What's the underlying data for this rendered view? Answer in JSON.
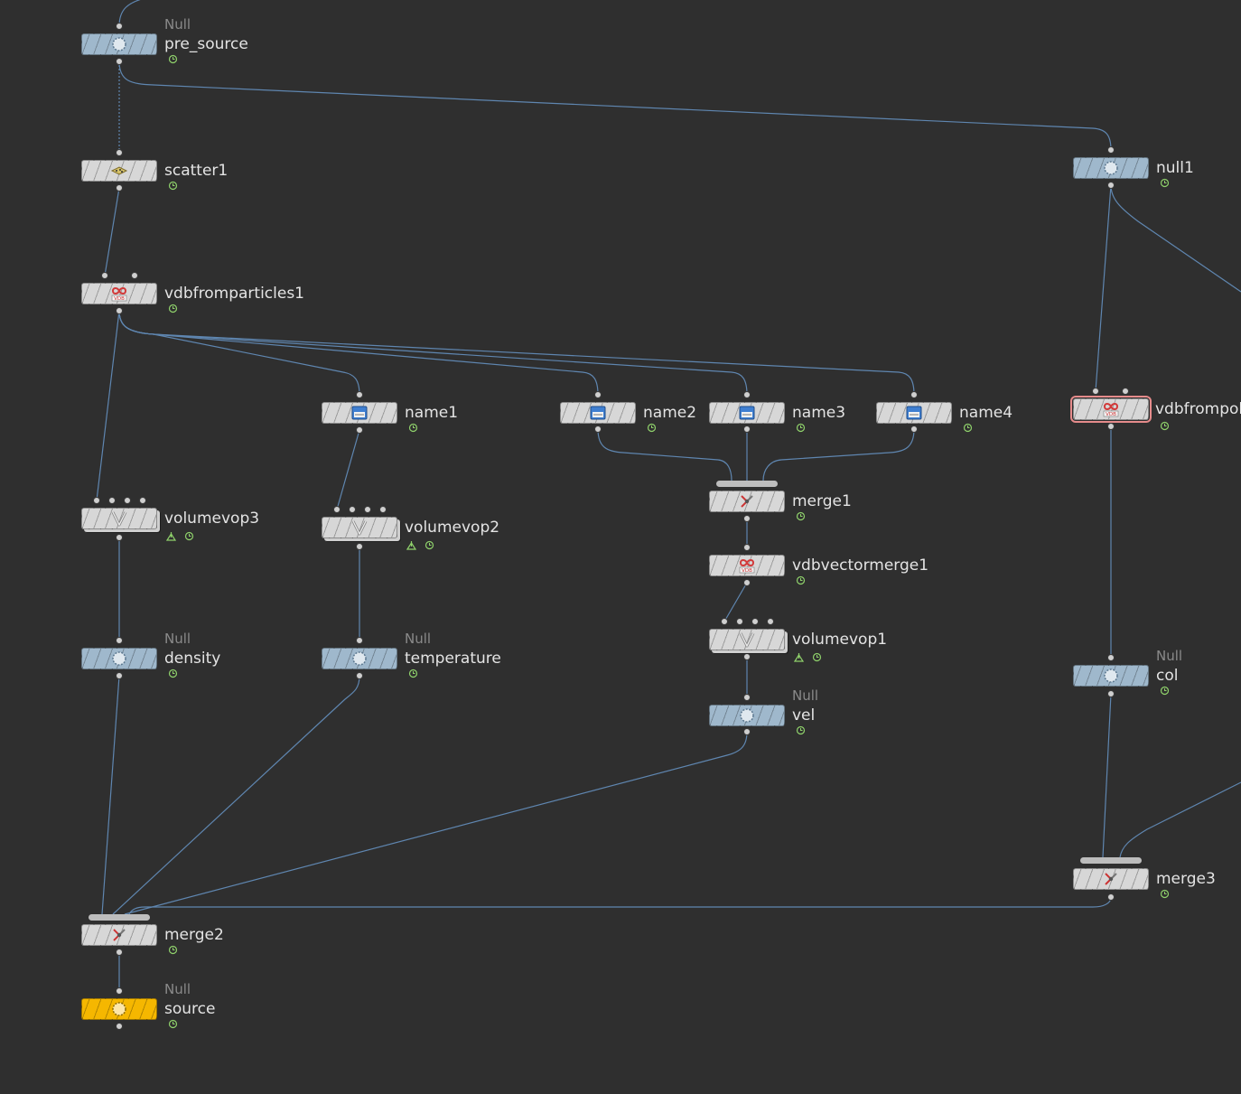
{
  "network": {
    "nodes": {
      "pre_source": {
        "name": "pre_source",
        "type": "Null"
      },
      "scatter1": {
        "name": "scatter1"
      },
      "vdbfromparticles1": {
        "name": "vdbfromparticles1"
      },
      "name1": {
        "name": "name1"
      },
      "name2": {
        "name": "name2"
      },
      "name3": {
        "name": "name3"
      },
      "name4": {
        "name": "name4"
      },
      "volumevop3": {
        "name": "volumevop3"
      },
      "volumevop2": {
        "name": "volumevop2"
      },
      "merge1": {
        "name": "merge1"
      },
      "vdbvectormerge1": {
        "name": "vdbvectormerge1"
      },
      "volumevop1": {
        "name": "volumevop1"
      },
      "density": {
        "name": "density",
        "type": "Null"
      },
      "temperature": {
        "name": "temperature",
        "type": "Null"
      },
      "vel": {
        "name": "vel",
        "type": "Null"
      },
      "null1": {
        "name": "null1"
      },
      "vdbfrompoly": {
        "name": "vdbfrompoly"
      },
      "col": {
        "name": "col",
        "type": "Null"
      },
      "merge3": {
        "name": "merge3"
      },
      "merge2": {
        "name": "merge2"
      },
      "source": {
        "name": "source",
        "type": "Null"
      }
    }
  },
  "icons": {
    "null": "null-circle-icon",
    "scatter": "scatter-icon",
    "vdb": "vdb-icon",
    "name": "name-sop-icon",
    "volumevop": "volumevop-icon",
    "merge": "merge-icon"
  },
  "colors": {
    "background": "#2f2f2f",
    "wire": "#5f86b0",
    "null_node": "#9fb8cc",
    "display_node": "#f5b700",
    "default_node": "#d7d7d7",
    "selected_outline": "#e58b8b",
    "flag_green": "#8fd16b"
  }
}
